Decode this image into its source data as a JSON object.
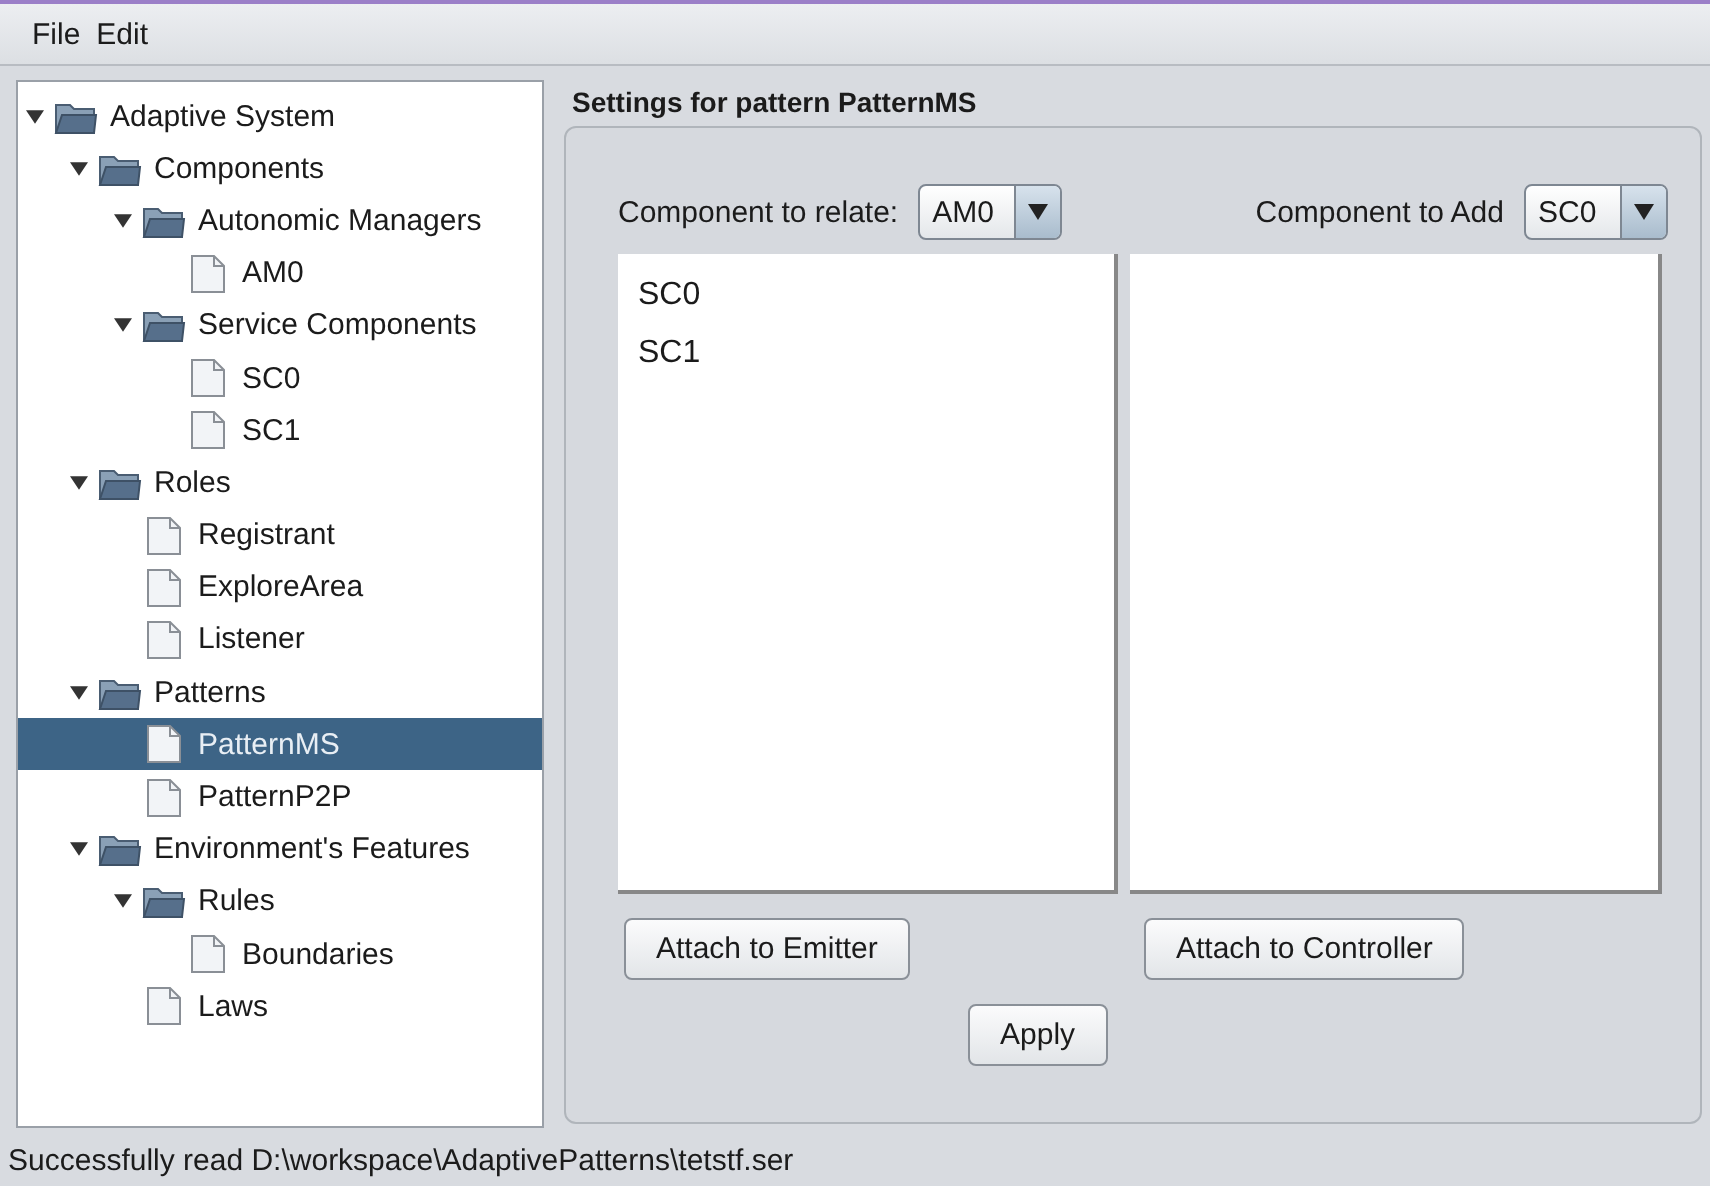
{
  "menu": [
    "File",
    "Edit"
  ],
  "tree": [
    {
      "label": "Adaptive System",
      "kind": "folder",
      "expanded": true,
      "selected": false,
      "children": [
        {
          "label": "Components",
          "kind": "folder",
          "expanded": true,
          "selected": false,
          "children": [
            {
              "label": "Autonomic Managers",
              "kind": "folder",
              "expanded": true,
              "selected": false,
              "children": [
                {
                  "label": "AM0",
                  "kind": "leaf",
                  "selected": false
                }
              ]
            },
            {
              "label": "Service Components",
              "kind": "folder",
              "expanded": true,
              "selected": false,
              "children": [
                {
                  "label": "SC0",
                  "kind": "leaf",
                  "selected": false
                },
                {
                  "label": "SC1",
                  "kind": "leaf",
                  "selected": false
                }
              ]
            }
          ]
        },
        {
          "label": "Roles",
          "kind": "folder",
          "expanded": true,
          "selected": false,
          "children": [
            {
              "label": "Registrant",
              "kind": "leaf",
              "selected": false
            },
            {
              "label": "ExploreArea",
              "kind": "leaf",
              "selected": false
            },
            {
              "label": "Listener",
              "kind": "leaf",
              "selected": false
            }
          ]
        },
        {
          "label": "Patterns",
          "kind": "folder",
          "expanded": true,
          "selected": false,
          "children": [
            {
              "label": "PatternMS",
              "kind": "leaf",
              "selected": true
            },
            {
              "label": "PatternP2P",
              "kind": "leaf",
              "selected": false
            }
          ]
        },
        {
          "label": "Environment's Features",
          "kind": "folder",
          "expanded": true,
          "selected": false,
          "children": [
            {
              "label": "Rules",
              "kind": "folder",
              "expanded": true,
              "selected": false,
              "children": [
                {
                  "label": "Boundaries",
                  "kind": "leaf",
                  "selected": false
                }
              ]
            },
            {
              "label": "Laws",
              "kind": "leaf",
              "selected": false
            }
          ]
        }
      ]
    }
  ],
  "settings": {
    "title": "Settings for pattern PatternMS",
    "relate": {
      "label": "Component to relate:",
      "value": "AM0"
    },
    "add": {
      "label": "Component to Add",
      "value": "SC0"
    },
    "left_list": [
      "SC0",
      "SC1"
    ],
    "attach_buttons": [
      "Attach to Emitter",
      "Attach to Controller"
    ],
    "apply": "Apply"
  },
  "status_bar": "Successfully read D:\\workspace\\AdaptivePatterns\\tetstf.ser"
}
